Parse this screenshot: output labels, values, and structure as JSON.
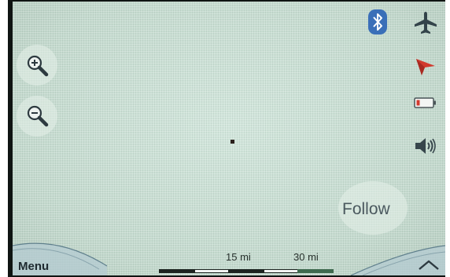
{
  "map": {
    "zoom_in_icon": "zoom-in-magnifier",
    "zoom_out_icon": "zoom-out-magnifier",
    "follow_label": "Follow",
    "menu_label": "Menu"
  },
  "status": {
    "bluetooth_icon": "bluetooth-icon",
    "airplane_icon": "airplane-icon",
    "gps_icon": "gps-signal-icon",
    "battery_icon": "battery-low-icon",
    "volume_icon": "speaker-volume-icon"
  },
  "scale": {
    "label_1": "15 mi",
    "label_2": "30 mi"
  },
  "colors": {
    "map_background": "#c7ddd1",
    "bluetooth_blue": "#3a6fb8",
    "gps_red": "#d23a2e",
    "text_dark": "#1f2a30"
  }
}
